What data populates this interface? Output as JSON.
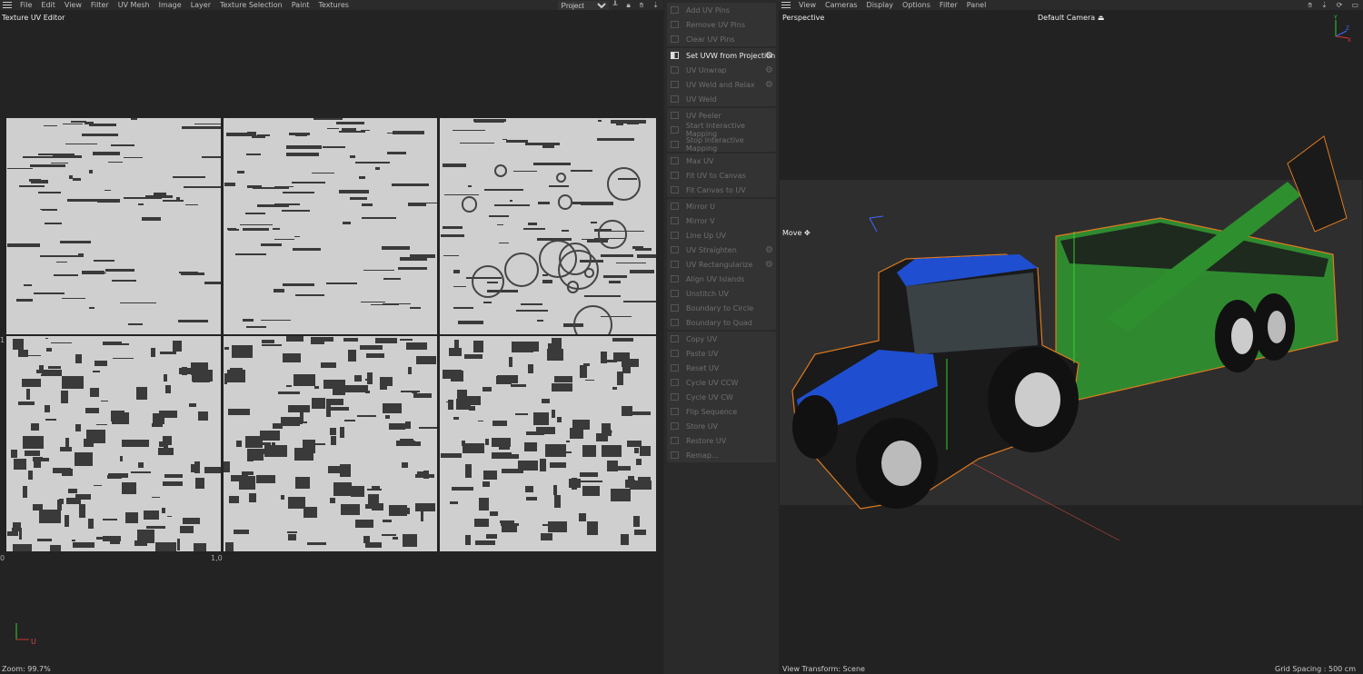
{
  "uv_editor": {
    "menu": [
      "File",
      "Edit",
      "View",
      "Filter",
      "UV Mesh",
      "Image",
      "Layer",
      "Texture Selection",
      "Paint",
      "Textures"
    ],
    "project_select": "Project",
    "title": "Texture UV Editor",
    "axis_labels": {
      "origin": "0",
      "u_end": "1,0",
      "v_end": "1"
    },
    "axis_u": "U",
    "zoom": "Zoom: 99.7%"
  },
  "uv_commands": {
    "groups": [
      [
        {
          "label": "Add UV Pins"
        },
        {
          "label": "Remove UV Pins"
        },
        {
          "label": "Clear UV Pins"
        }
      ],
      [
        {
          "label": "Set UVW from Projection",
          "active": true,
          "gear": true
        },
        {
          "label": "UV Unwrap",
          "gear": true
        },
        {
          "label": "UV Weld and Relax",
          "gear": true
        },
        {
          "label": "UV Weld"
        }
      ],
      [
        {
          "label": "UV Peeler"
        },
        {
          "label": "Start Interactive Mapping"
        },
        {
          "label": "Stop Interactive Mapping"
        }
      ],
      [
        {
          "label": "Max UV"
        },
        {
          "label": "Fit UV to Canvas"
        },
        {
          "label": "Fit Canvas to UV"
        }
      ],
      [
        {
          "label": "Mirror U"
        },
        {
          "label": "Mirror V"
        },
        {
          "label": "Line Up UV"
        },
        {
          "label": "UV Straighten",
          "gear": true
        },
        {
          "label": "UV Rectangularize",
          "gear": true
        },
        {
          "label": "Align UV Islands"
        },
        {
          "label": "Unstitch UV"
        },
        {
          "label": "Boundary to Circle"
        },
        {
          "label": "Boundary to Quad"
        }
      ],
      [
        {
          "label": "Copy UV"
        },
        {
          "label": "Paste UV"
        },
        {
          "label": "Reset UV"
        },
        {
          "label": "Cycle UV CCW"
        },
        {
          "label": "Cycle UV CW"
        },
        {
          "label": "Flip Sequence"
        },
        {
          "label": "Store UV"
        },
        {
          "label": "Restore UV"
        },
        {
          "label": "Remap..."
        }
      ]
    ]
  },
  "viewport": {
    "menu": [
      "View",
      "Cameras",
      "Display",
      "Options",
      "Filter",
      "Panel"
    ],
    "view_name": "Perspective",
    "camera": "Default Camera",
    "tool": "Move",
    "view_transform": "View Transform: Scene",
    "grid_spacing": "Grid Spacing : 500 cm",
    "axes": {
      "y": "Y",
      "z": "Z",
      "x": "X"
    },
    "colors": {
      "tractor": "#1f4fd0",
      "trailer": "#2f8a2f",
      "selection": "#e07a1f"
    }
  }
}
